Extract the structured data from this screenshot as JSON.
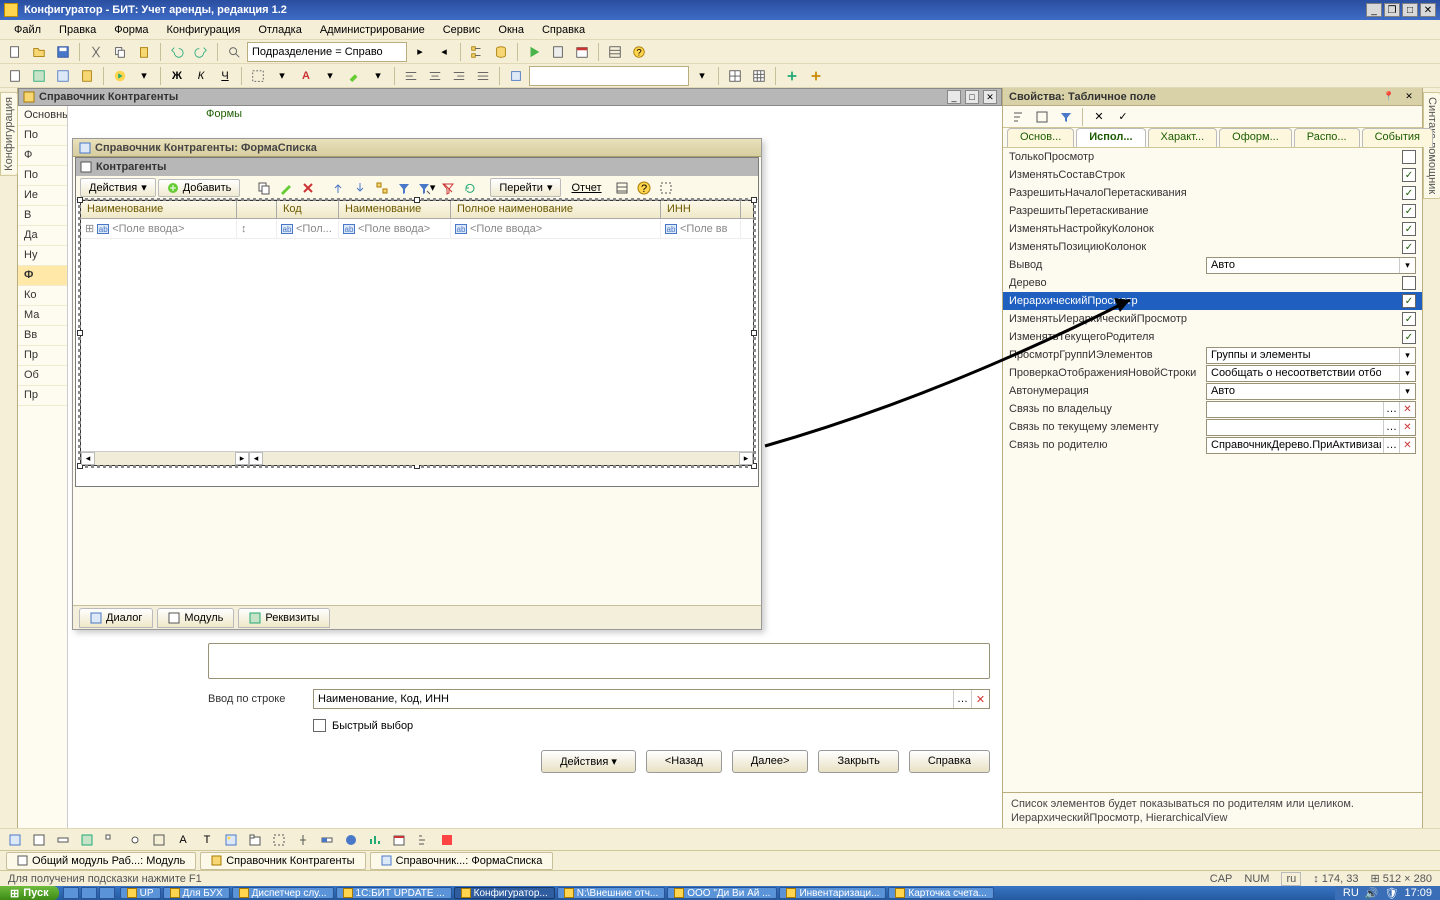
{
  "title": "Конфигуратор - БИТ: Учет аренды, редакция 1.2",
  "menubar": [
    "Файл",
    "Правка",
    "Форма",
    "Конфигурация",
    "Отладка",
    "Администрирование",
    "Сервис",
    "Окна",
    "Справка"
  ],
  "toolbar1": {
    "search_placeholder": "Подразделение = Справо"
  },
  "vtab_left": "Конфигурация",
  "vtab_right": "Синтакс-помощник",
  "subwin1_title": "Справочник Контрагенты",
  "tree_items": [
    "Основные",
    "По",
    "Ф",
    "По",
    "Ие",
    "В",
    "Да",
    "Ну",
    "Ф",
    "Ко",
    "Ма",
    "Вв",
    "Пр",
    "Об",
    "Пр"
  ],
  "tree_active_index": 8,
  "formlist_tab": "Формы",
  "subwin2_title": "Справочник Контрагенты: ФормаСписка",
  "fd_title": "Контрагенты",
  "fd_toolbar": {
    "actions": "Действия",
    "add": "Добавить",
    "goto": "Перейти",
    "report": "Отчет"
  },
  "grid": {
    "headers": [
      "Наименование",
      "",
      "Код",
      "Наименование",
      "Полное наименование",
      "ИНН"
    ],
    "widths": [
      156,
      40,
      62,
      112,
      210,
      80
    ],
    "row": [
      "<Поле ввода>",
      "",
      "<Пол...",
      "<Поле ввода>",
      "<Поле ввода>",
      "<Поле вв"
    ]
  },
  "tabs2": [
    "Диалог",
    "Модуль",
    "Реквизиты"
  ],
  "lower": {
    "label1": "Ввод по строке",
    "input1": "Наименование, Код, ИНН",
    "chk1": "Быстрый выбор",
    "buttons": [
      "Действия ▾",
      "<Назад",
      "Далее>",
      "Закрыть",
      "Справка"
    ]
  },
  "props": {
    "title": "Свойства: Табличное поле",
    "tabs": [
      "Основ...",
      "Испол...",
      "Характ...",
      "Оформ...",
      "Распо...",
      "События"
    ],
    "active_tab_index": 1,
    "rows_chk": [
      {
        "label": "ТолькоПросмотр",
        "v": false
      },
      {
        "label": "ИзменятьСоставСтрок",
        "v": true
      },
      {
        "label": "РазрешитьНачалоПеретаскивания",
        "v": true
      },
      {
        "label": "РазрешитьПеретаскивание",
        "v": true
      },
      {
        "label": "ИзменятьНастройкуКолонок",
        "v": true
      },
      {
        "label": "ИзменятьПозициюКолонок",
        "v": true
      }
    ],
    "row_vyvod": {
      "label": "Вывод",
      "value": "Авто"
    },
    "row_derevo": {
      "label": "Дерево",
      "v": false
    },
    "row_hier": {
      "label": "ИерархическийПросмотр",
      "v": true
    },
    "rows_chk2": [
      {
        "label": "ИзменятьИерархическийПросмотр",
        "v": true
      },
      {
        "label": "ИзменятьТекущегоРодителя",
        "v": true
      }
    ],
    "row_pg": {
      "label": "ПросмотрГруппИЭлементов",
      "value": "Группы и элементы"
    },
    "row_check": {
      "label": "ПроверкаОтображенияНовойСтроки",
      "value": "Сообщать о несоответствии отбору"
    },
    "row_autonum": {
      "label": "Автонумерация",
      "value": "Авто"
    },
    "row_owner": {
      "label": "Связь по владельцу",
      "value": ""
    },
    "row_current": {
      "label": "Связь по текущему элементу",
      "value": ""
    },
    "row_parent": {
      "label": "Связь по родителю",
      "value": "СправочникДерево.ПриАктивизации"
    },
    "help": "Список элементов будет показываться по родителям или целиком. ИерархическийПросмотр, HierarchicalView"
  },
  "wtabs": [
    "Общий модуль Раб...: Модуль",
    "Справочник Контрагенты",
    "Справочник...: ФормаСписка"
  ],
  "statusbar": {
    "left": "Для получения подсказки нажмите F1",
    "cap": "CAP",
    "num": "NUM",
    "lang": "ru",
    "coords": "↕ 174, 33",
    "size": "⊞ 512 × 280"
  },
  "taskbar": {
    "start": "Пуск",
    "items": [
      {
        "t": "UP"
      },
      {
        "t": "Для БУХ"
      },
      {
        "t": "Диспетчер слу..."
      },
      {
        "t": "1С:БИТ UPDATE ..."
      },
      {
        "t": "Конфигуратор...",
        "active": true
      },
      {
        "t": "N:\\Внешние отч..."
      },
      {
        "t": "ООО \"Ди Ви Ай ..."
      },
      {
        "t": "Инвентаризаци..."
      },
      {
        "t": "Карточка счета..."
      }
    ],
    "tray_lang": "RU",
    "tray_time": "17:09"
  }
}
